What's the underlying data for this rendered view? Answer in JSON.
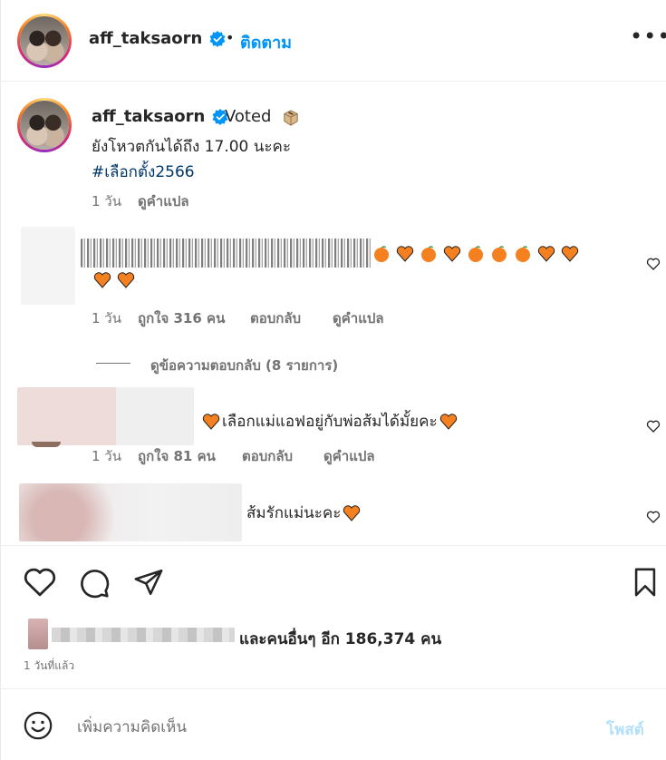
{
  "header": {
    "username": "aff_taksaorn",
    "separator": "•",
    "follow_label": "ติดตาม",
    "more_label": "•••",
    "verified_icon": "verified-badge-icon"
  },
  "caption": {
    "username": "aff_taksaorn",
    "voted": "Voted",
    "voted_icon": "ballot-box-icon",
    "line1": "ยังโหวตกันได้ถึง 17.00 นะคะ",
    "hashtag": "#เลือกตั้ง2566",
    "time": "1 วัน",
    "translate": "ดูคำแปล"
  },
  "comments": [
    {
      "text_visible": "",
      "emoji_row1": [
        "tangerine",
        "orange-heart",
        "tangerine",
        "orange-heart",
        "tangerine",
        "tangerine",
        "tangerine",
        "orange-heart",
        "orange-heart"
      ],
      "emoji_row2": [
        "orange-heart",
        "orange-heart"
      ],
      "time": "1 วัน",
      "likes": "ถูกใจ 316 คน",
      "reply": "ตอบกลับ",
      "translate": "ดูคำแปล"
    },
    {
      "text": "เลือกแม่แอฟอยู่กับพ่อส้มได้มั้ยคะ",
      "time": "1 วัน",
      "likes": "ถูกใจ 81 คน",
      "reply": "ตอบกลับ",
      "translate": "ดูคำแปล"
    },
    {
      "text": "ส้มรักแม่นะคะ"
    }
  ],
  "view_replies": "ดูข้อความตอบกลับ (8 รายการ)",
  "actions": {
    "like_icon": "heart-icon",
    "comment_icon": "comment-icon",
    "share_icon": "send-icon",
    "save_icon": "bookmark-icon"
  },
  "likes_summary": "และคนอื่นๆ อีก 186,374 คน",
  "time_ago": "1 วันที่แล้ว",
  "composer": {
    "placeholder": "เพิ่มความคิดเห็น",
    "post_label": "โพสต์"
  },
  "colors": {
    "link_blue": "#0095f6",
    "hashtag": "#00376b",
    "muted": "#737373",
    "post_disabled": "#b2dffc",
    "orange": "#f4801f"
  }
}
